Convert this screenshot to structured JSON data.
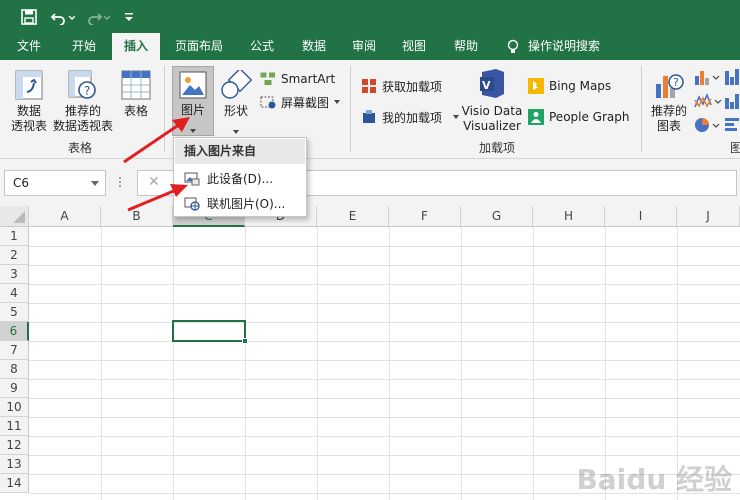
{
  "colors": {
    "brand": "#217346",
    "ribbon_bg": "#f3f3f3",
    "selected_button": "#c6c6c6",
    "arrow": "#e02020",
    "cell_selection": "#217346"
  },
  "quick_access": {
    "save_icon": "save-icon",
    "undo_icon": "undo-icon",
    "redo_icon": "redo-icon",
    "customize_icon": "customize-qat-icon"
  },
  "tabs": [
    {
      "label": "文件",
      "active": false
    },
    {
      "label": "开始",
      "active": false
    },
    {
      "label": "插入",
      "active": true
    },
    {
      "label": "页面布局",
      "active": false
    },
    {
      "label": "公式",
      "active": false
    },
    {
      "label": "数据",
      "active": false
    },
    {
      "label": "审阅",
      "active": false
    },
    {
      "label": "视图",
      "active": false
    },
    {
      "label": "帮助",
      "active": false
    }
  ],
  "tell_me": "操作说明搜索",
  "ribbon": {
    "tables": {
      "pivot_line1": "数据",
      "pivot_line2": "透视表",
      "rec_pivot_line1": "推荐的",
      "rec_pivot_line2": "数据透视表",
      "table": "表格",
      "group_label": "表格"
    },
    "illustrations": {
      "pictures": "图片",
      "shapes": "形状",
      "smartart": "SmartArt",
      "screenshot": "屏幕截图"
    },
    "addins": {
      "get_addins": "获取加载项",
      "my_addins": "我的加载项",
      "visio_line1": "Visio Data",
      "visio_line2": "Visualizer",
      "bing_maps": "Bing Maps",
      "people_graph": "People Graph",
      "group_label": "加载项"
    },
    "charts": {
      "rec_charts_line1": "推荐的",
      "rec_charts_line2": "图表",
      "group_label_partial": "图"
    }
  },
  "dropdown": {
    "header": "插入图片来自",
    "items": [
      "此设备(D)...",
      "联机图片(O)..."
    ]
  },
  "namebox": "C6",
  "columns": [
    "A",
    "B",
    "C",
    "D",
    "E",
    "F",
    "G",
    "H",
    "I",
    "J"
  ],
  "rows": [
    "1",
    "2",
    "3",
    "4",
    "5",
    "6",
    "7",
    "8",
    "9",
    "10",
    "11",
    "12",
    "13",
    "14"
  ],
  "selected_cell": "C6",
  "watermark": "Baidu 经验"
}
